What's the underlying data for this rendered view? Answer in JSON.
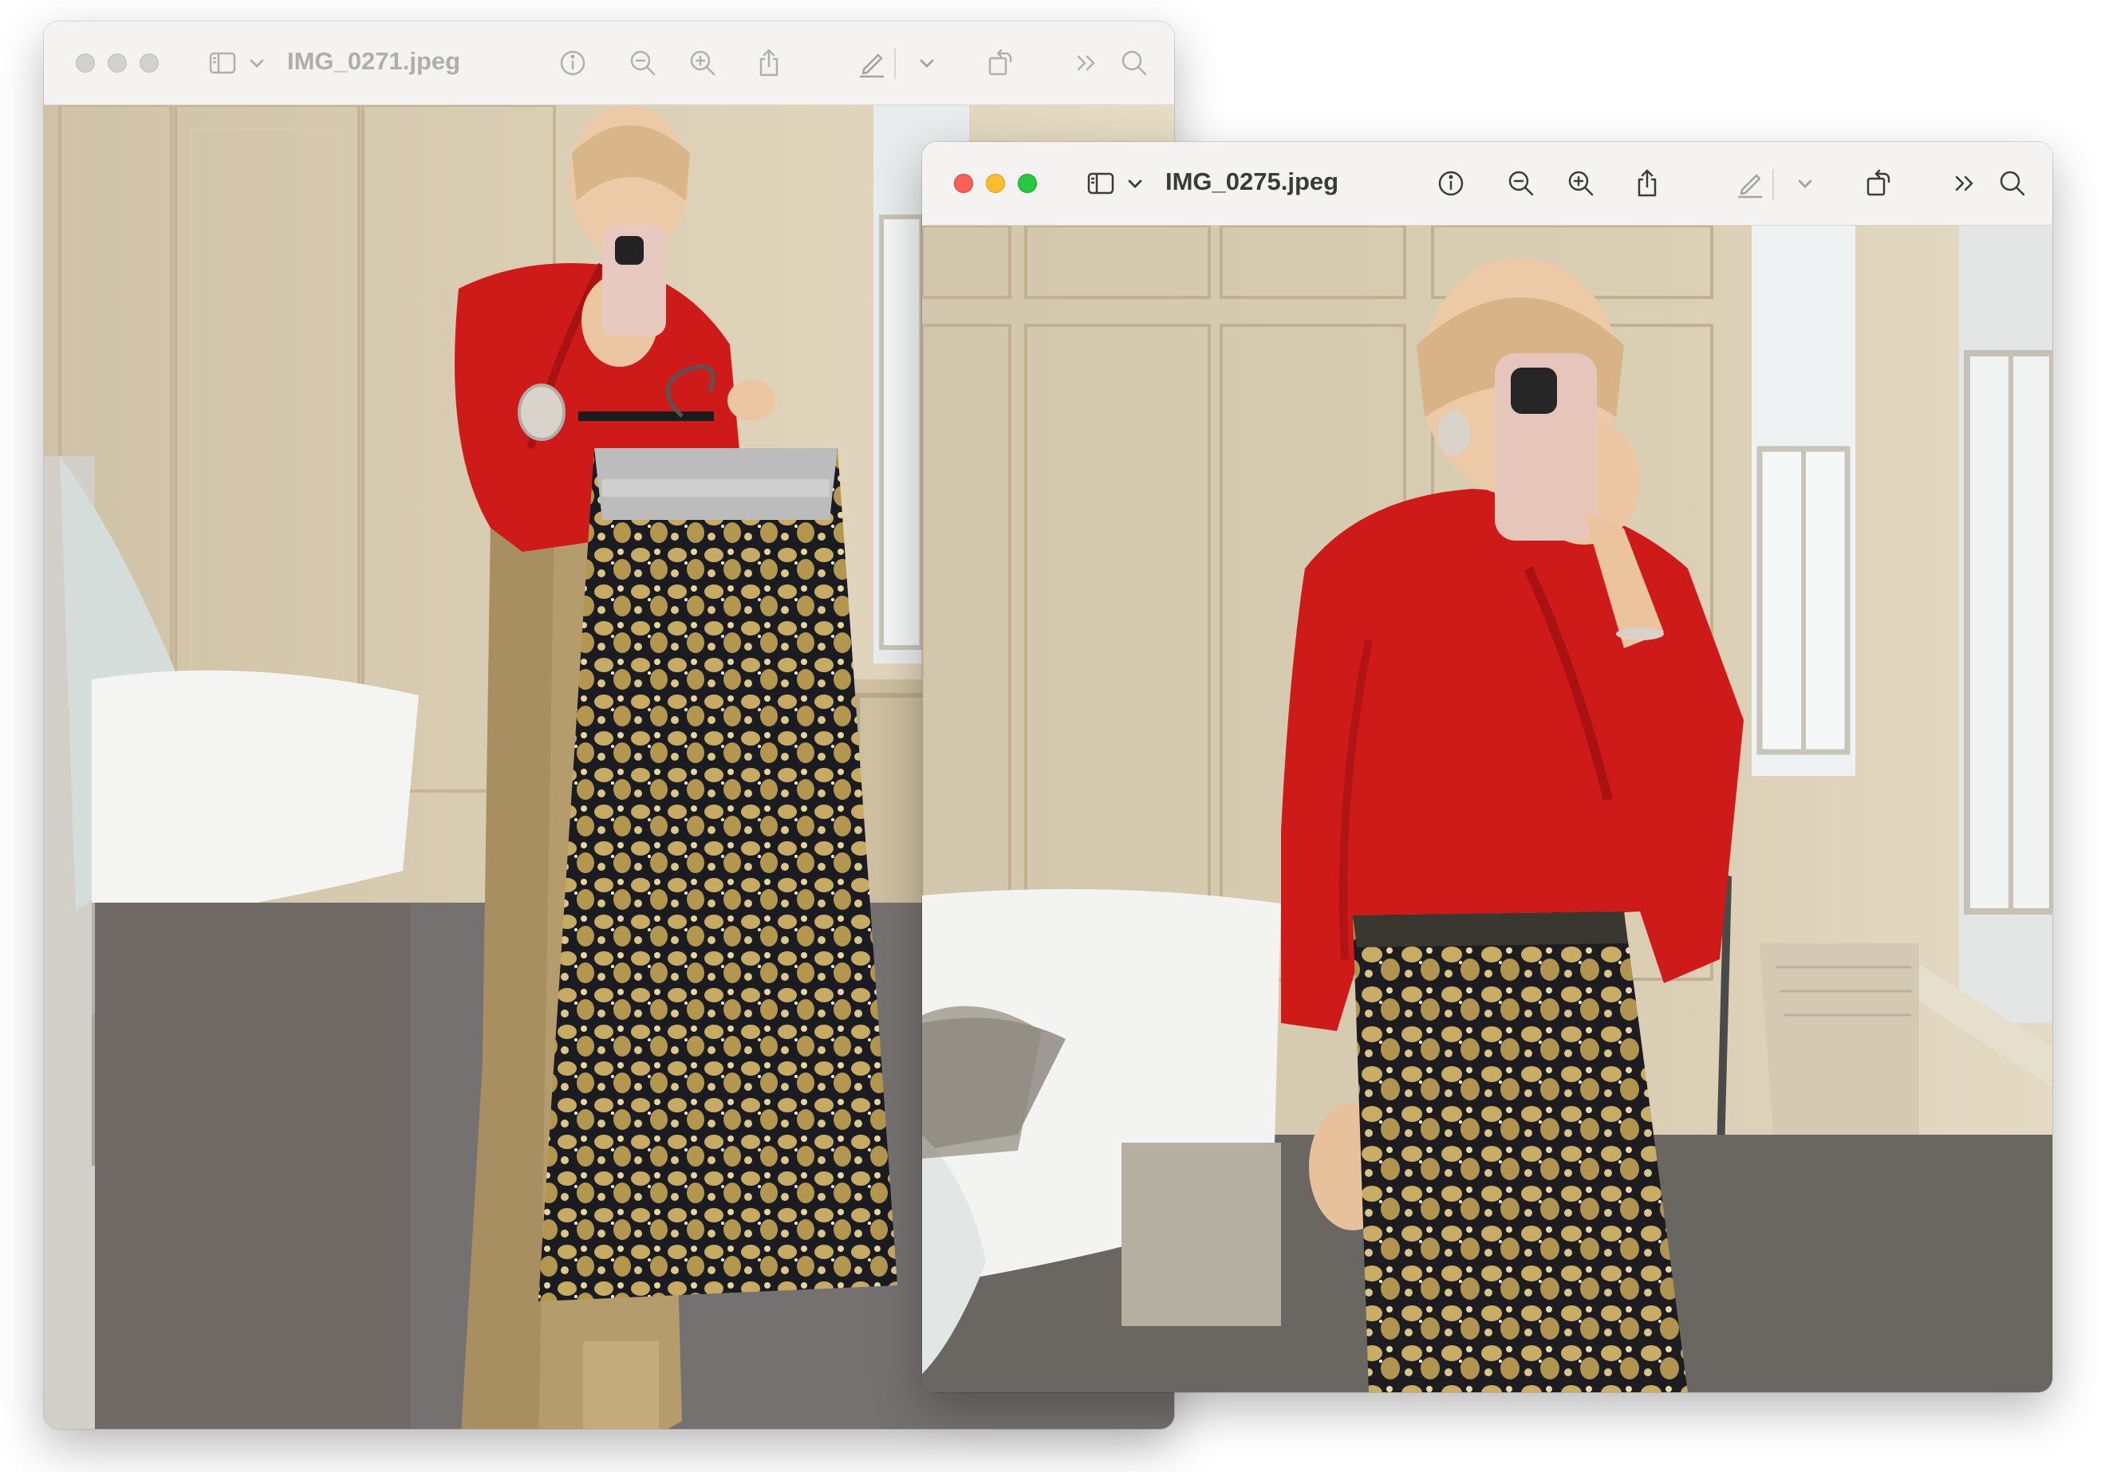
{
  "windows": [
    {
      "id": "back",
      "title": "IMG_0271.jpeg",
      "state": "inactive",
      "photo": "mirror selfie: woman in red sweater and camel wide-leg trousers holding a gold and black sequin skirt on a hanger"
    },
    {
      "id": "front",
      "title": "IMG_0275.jpeg",
      "state": "active",
      "photo": "mirror selfie: woman in red sweater wearing a gold and black sequin midi skirt"
    }
  ],
  "toolbar_icons": [
    "sidebar-toggle-icon",
    "chevron-down-icon",
    "info-icon",
    "zoom-out-icon",
    "zoom-in-icon",
    "share-icon",
    "markup-pen-icon",
    "chevron-down-icon",
    "rotate-icon",
    "more-chevrons-icon",
    "search-icon"
  ],
  "colors": {
    "close": "#fe5f57",
    "minimize": "#febc2e",
    "maximize": "#28c840",
    "inactive_traffic": "#d3d1cf",
    "sweater_red": "#cf1a1a",
    "sequin_gold": "#b89a4e",
    "trousers_camel": "#b59c6c"
  }
}
